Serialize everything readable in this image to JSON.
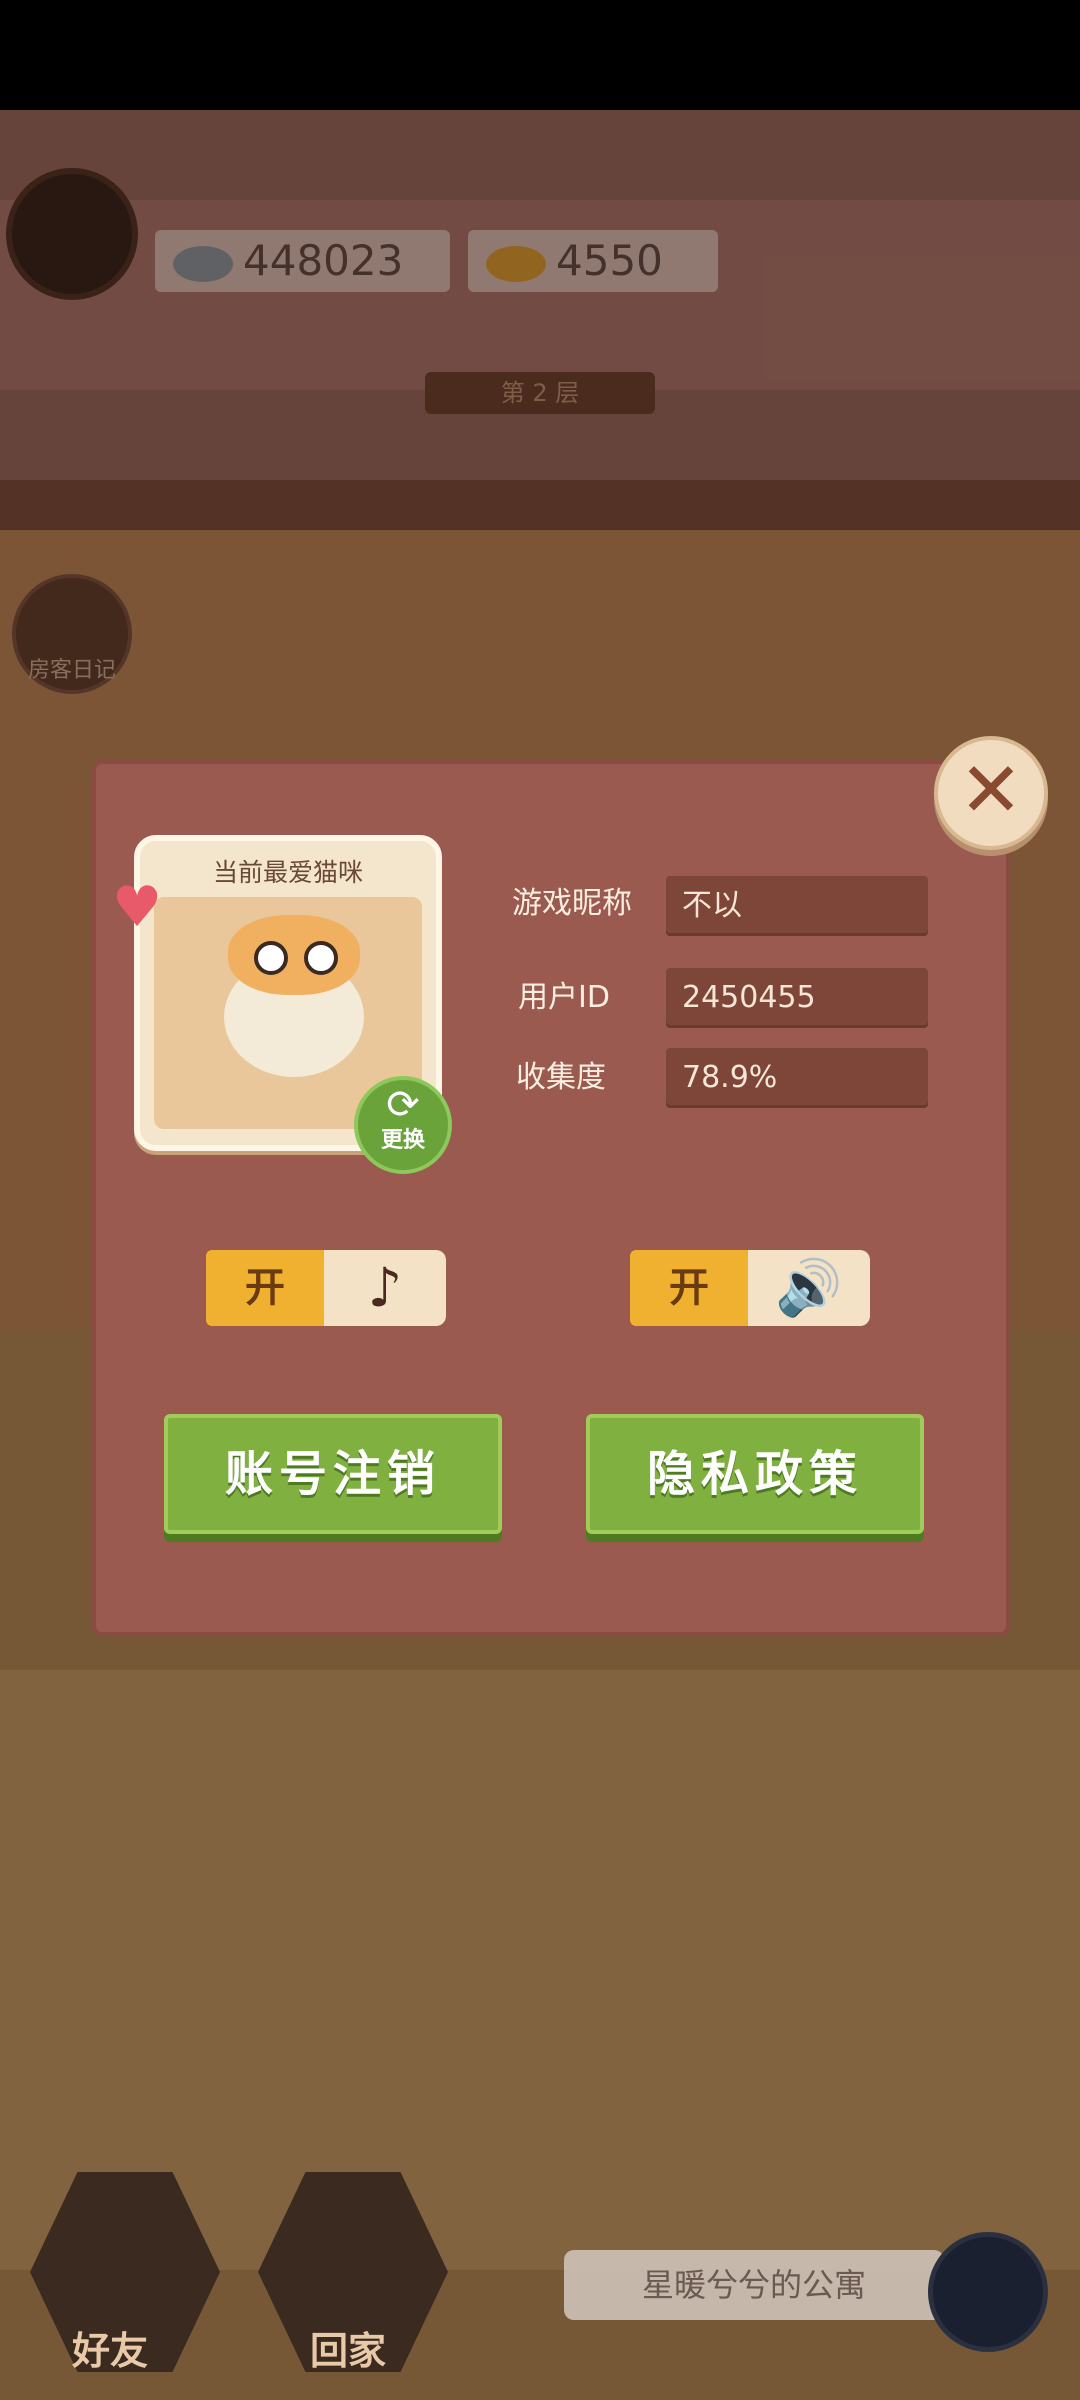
{
  "hud": {
    "fish_silver": "448023",
    "fish_gold": "4550",
    "floor_label": "第 2 层",
    "diary_label": "房客日记"
  },
  "dialog": {
    "card_title": "当前最爱猫咪",
    "swap_label": "更换",
    "nickname_label": "游戏昵称",
    "nickname_value": "不以",
    "userid_label": "用户ID",
    "userid_value": "2450455",
    "collection_label": "收集度",
    "collection_value": "78.9%",
    "music_toggle": {
      "label": "开",
      "icon": "music-note-icon",
      "state": "on"
    },
    "sound_toggle": {
      "label": "开",
      "icon": "speaker-icon",
      "state": "on"
    },
    "cancel_account_button": "账号注销",
    "privacy_policy_button": "隐私政策",
    "close_icon": "close-icon"
  },
  "bottom": {
    "friends_label": "好友",
    "home_label": "回家",
    "apartment_name": "星暖兮兮的公寓"
  },
  "colors": {
    "dialog_bg": "#9a5a50",
    "green_button": "#80b040",
    "toggle_on": "#f0b030"
  }
}
